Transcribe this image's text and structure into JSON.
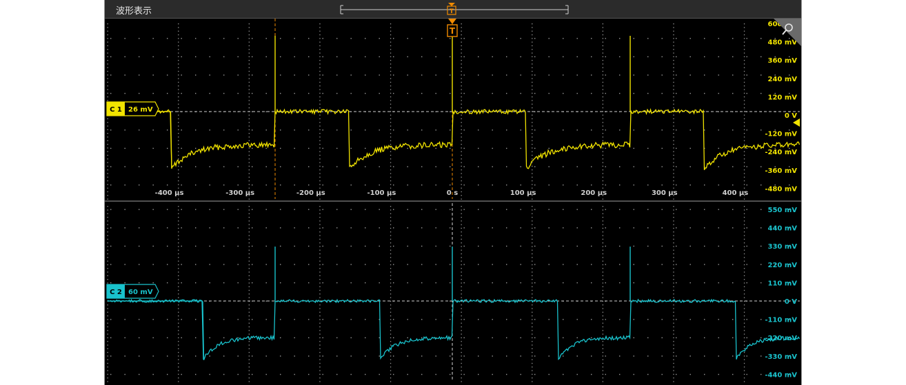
{
  "window": {
    "title": "波形表示"
  },
  "trigger": {
    "marker_label": "T",
    "position_label": "T"
  },
  "colors": {
    "ch1": "#f2e400",
    "ch2": "#19c2cc",
    "trigger": "#f08a00",
    "background": "#000000",
    "grid": "#9a9a9a",
    "time_label": "#cfcfcf"
  },
  "channels": [
    {
      "id": "ch1",
      "badge": "C 1",
      "scale": "26 mV",
      "offset_label": "0 V"
    },
    {
      "id": "ch2",
      "badge": "C 2",
      "scale": "60 mV",
      "offset_label": "0 V"
    }
  ],
  "ch1_axis": [
    "600 mV",
    "480 mV",
    "360 mV",
    "240 mV",
    "120 mV",
    "0 V",
    "-120 mV",
    "-240 mV",
    "-360 mV",
    "-480 mV"
  ],
  "ch2_axis": [
    "550 mV",
    "440 mV",
    "330 mV",
    "220 mV",
    "110 mV",
    "0 V",
    "-110 mV",
    "-220 mV",
    "-330 mV",
    "-440 mV"
  ],
  "time_axis": [
    "-400 µs",
    "-300 µs",
    "-200 µs",
    "-100 µs",
    "0 s",
    "100 µs",
    "200 µs",
    "300 µs",
    "400 µs"
  ],
  "icons": {
    "zoom": "magnifier-icon",
    "offset_arrow": "arrow-left-icon"
  }
}
